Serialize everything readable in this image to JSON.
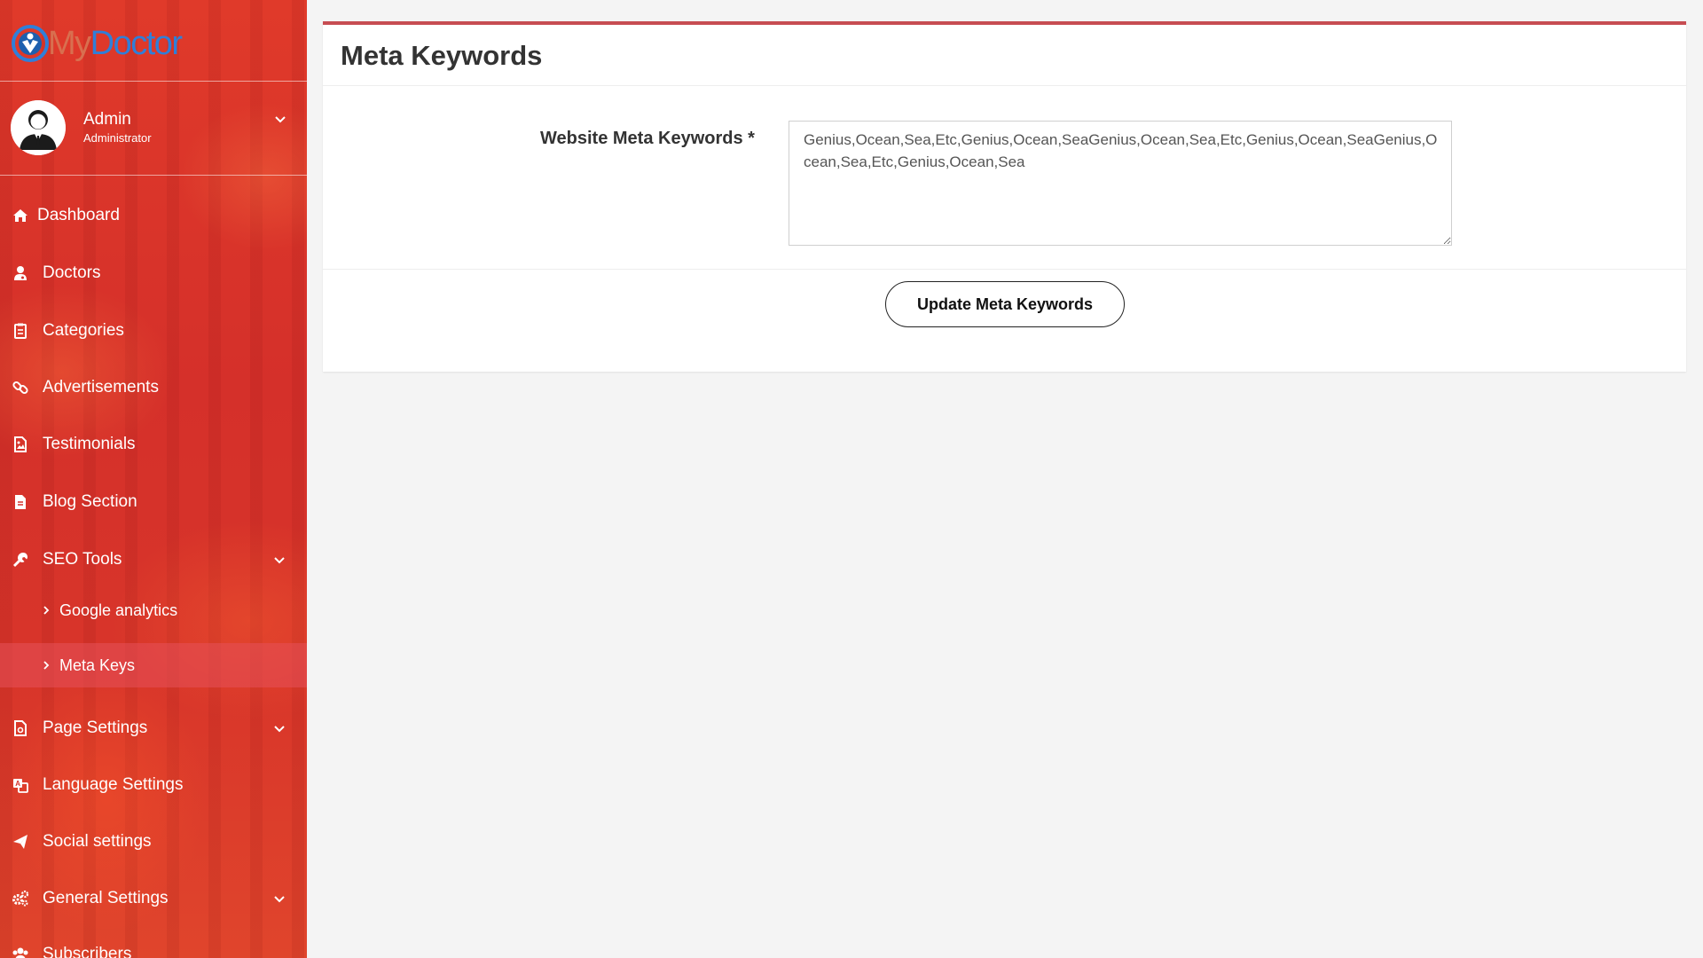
{
  "brand": {
    "my": "My",
    "doctor": "Doctor"
  },
  "user": {
    "name": "Admin",
    "role": "Administrator"
  },
  "nav": {
    "dashboard": "Dashboard",
    "doctors": "Doctors",
    "categories": "Categories",
    "advertisements": "Advertisements",
    "testimonials": "Testimonials",
    "blog": "Blog Section",
    "seo": "SEO Tools",
    "seo_sub": {
      "google": "Google analytics",
      "meta": "Meta Keys"
    },
    "page_settings": "Page Settings",
    "language": "Language Settings",
    "social": "Social settings",
    "general": "General Settings",
    "subscribers": "Subscribers"
  },
  "colors": {
    "sidebar": "#d9352a",
    "accent_border": "#c74d52",
    "active_sub": "#e6505a",
    "logo_blue": "#2f7fd9",
    "logo_orange": "#d86f4f"
  },
  "main": {
    "title": "Meta Keywords",
    "field_label": "Website Meta Keywords *",
    "keywords_value": "Genius,Ocean,Sea,Etc,Genius,Ocean,SeaGenius,Ocean,Sea,Etc,Genius,Ocean,SeaGenius,Ocean,Sea,Etc,Genius,Ocean,Sea",
    "button": "Update Meta Keywords"
  }
}
